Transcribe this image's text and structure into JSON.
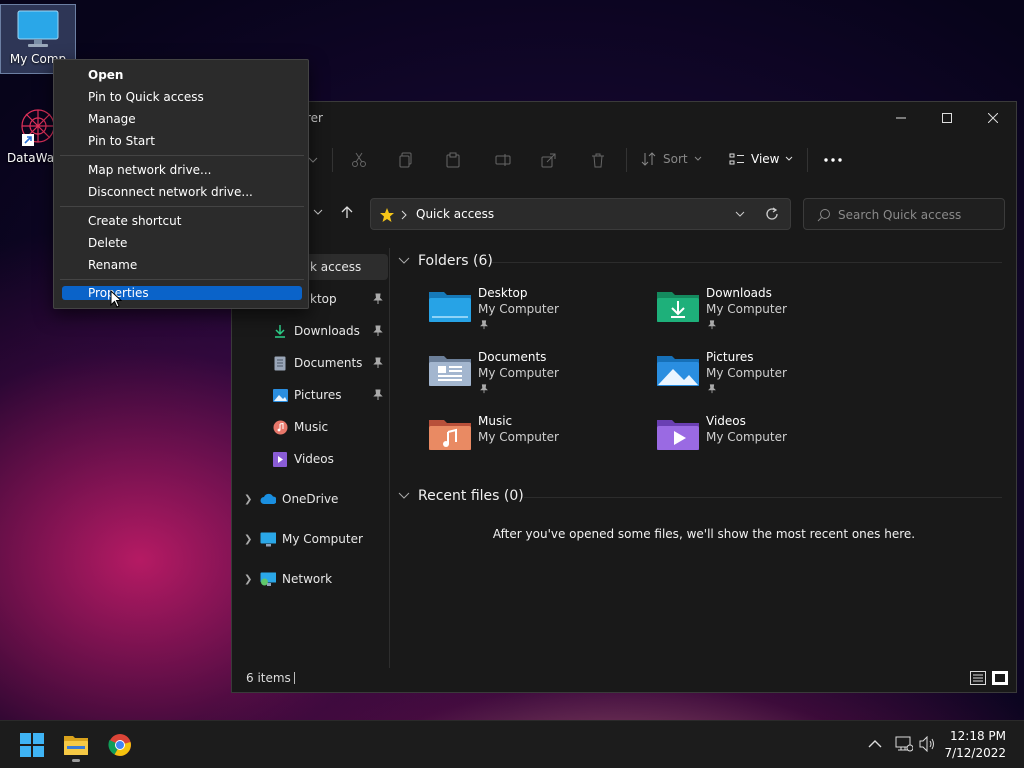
{
  "desktop": {
    "icons": [
      {
        "label": "My Comp",
        "icon": "monitor-icon"
      },
      {
        "label": "DataWage",
        "icon": "datawage-app-icon"
      }
    ]
  },
  "explorer": {
    "title": "rer",
    "toolbar": {
      "sort_label": "Sort",
      "view_label": "View"
    },
    "address": {
      "location": "Quick access"
    },
    "search": {
      "placeholder": "Search Quick access"
    },
    "nav": {
      "items": [
        {
          "label": "k access",
          "icon": "star-icon",
          "pinned": false,
          "selected": true
        },
        {
          "label": "ktop",
          "icon": "desktop-folder-icon",
          "pinned": true
        },
        {
          "label": "Downloads",
          "icon": "download-icon",
          "pinned": true
        },
        {
          "label": "Documents",
          "icon": "document-icon",
          "pinned": true
        },
        {
          "label": "Pictures",
          "icon": "pictures-icon",
          "pinned": true
        },
        {
          "label": "Music",
          "icon": "music-icon",
          "pinned": false
        },
        {
          "label": "Videos",
          "icon": "videos-icon",
          "pinned": false
        },
        {
          "label": "OneDrive",
          "icon": "cloud-icon",
          "pinned": false
        },
        {
          "label": "My Computer",
          "icon": "monitor-icon",
          "pinned": false
        },
        {
          "label": "Network",
          "icon": "network-icon",
          "pinned": false
        }
      ]
    },
    "folders_header": "Folders (6)",
    "folders": [
      {
        "name": "Desktop",
        "location": "My Computer",
        "pinned": true,
        "color": "#1e9ad6"
      },
      {
        "name": "Downloads",
        "location": "My Computer",
        "pinned": true,
        "color": "#1eb07a"
      },
      {
        "name": "Documents",
        "location": "My Computer",
        "pinned": true,
        "color": "#8fa6c4"
      },
      {
        "name": "Pictures",
        "location": "My Computer",
        "pinned": true,
        "color": "#2a8ee0"
      },
      {
        "name": "Music",
        "location": "My Computer",
        "pinned": false,
        "color": "#e36b4a"
      },
      {
        "name": "Videos",
        "location": "My Computer",
        "pinned": false,
        "color": "#8a5cd6"
      }
    ],
    "recent_header": "Recent files (0)",
    "recent_empty": "After you've opened some files, we'll show the most recent ones here.",
    "status": "6 items"
  },
  "context_menu": {
    "items": [
      {
        "label": "Open",
        "bold": true
      },
      {
        "label": "Pin to Quick access"
      },
      {
        "label": "Manage"
      },
      {
        "label": "Pin to Start"
      },
      {
        "label": "Map network drive..."
      },
      {
        "label": "Disconnect network drive..."
      },
      {
        "label": "Create shortcut"
      },
      {
        "label": "Delete"
      },
      {
        "label": "Rename"
      },
      {
        "label": "Properties",
        "selected": true
      }
    ]
  },
  "taskbar": {
    "time": "12:18 PM",
    "date": "7/12/2022"
  },
  "colors": {
    "accent": "#0a63c9",
    "explorer_bg": "#191919"
  }
}
